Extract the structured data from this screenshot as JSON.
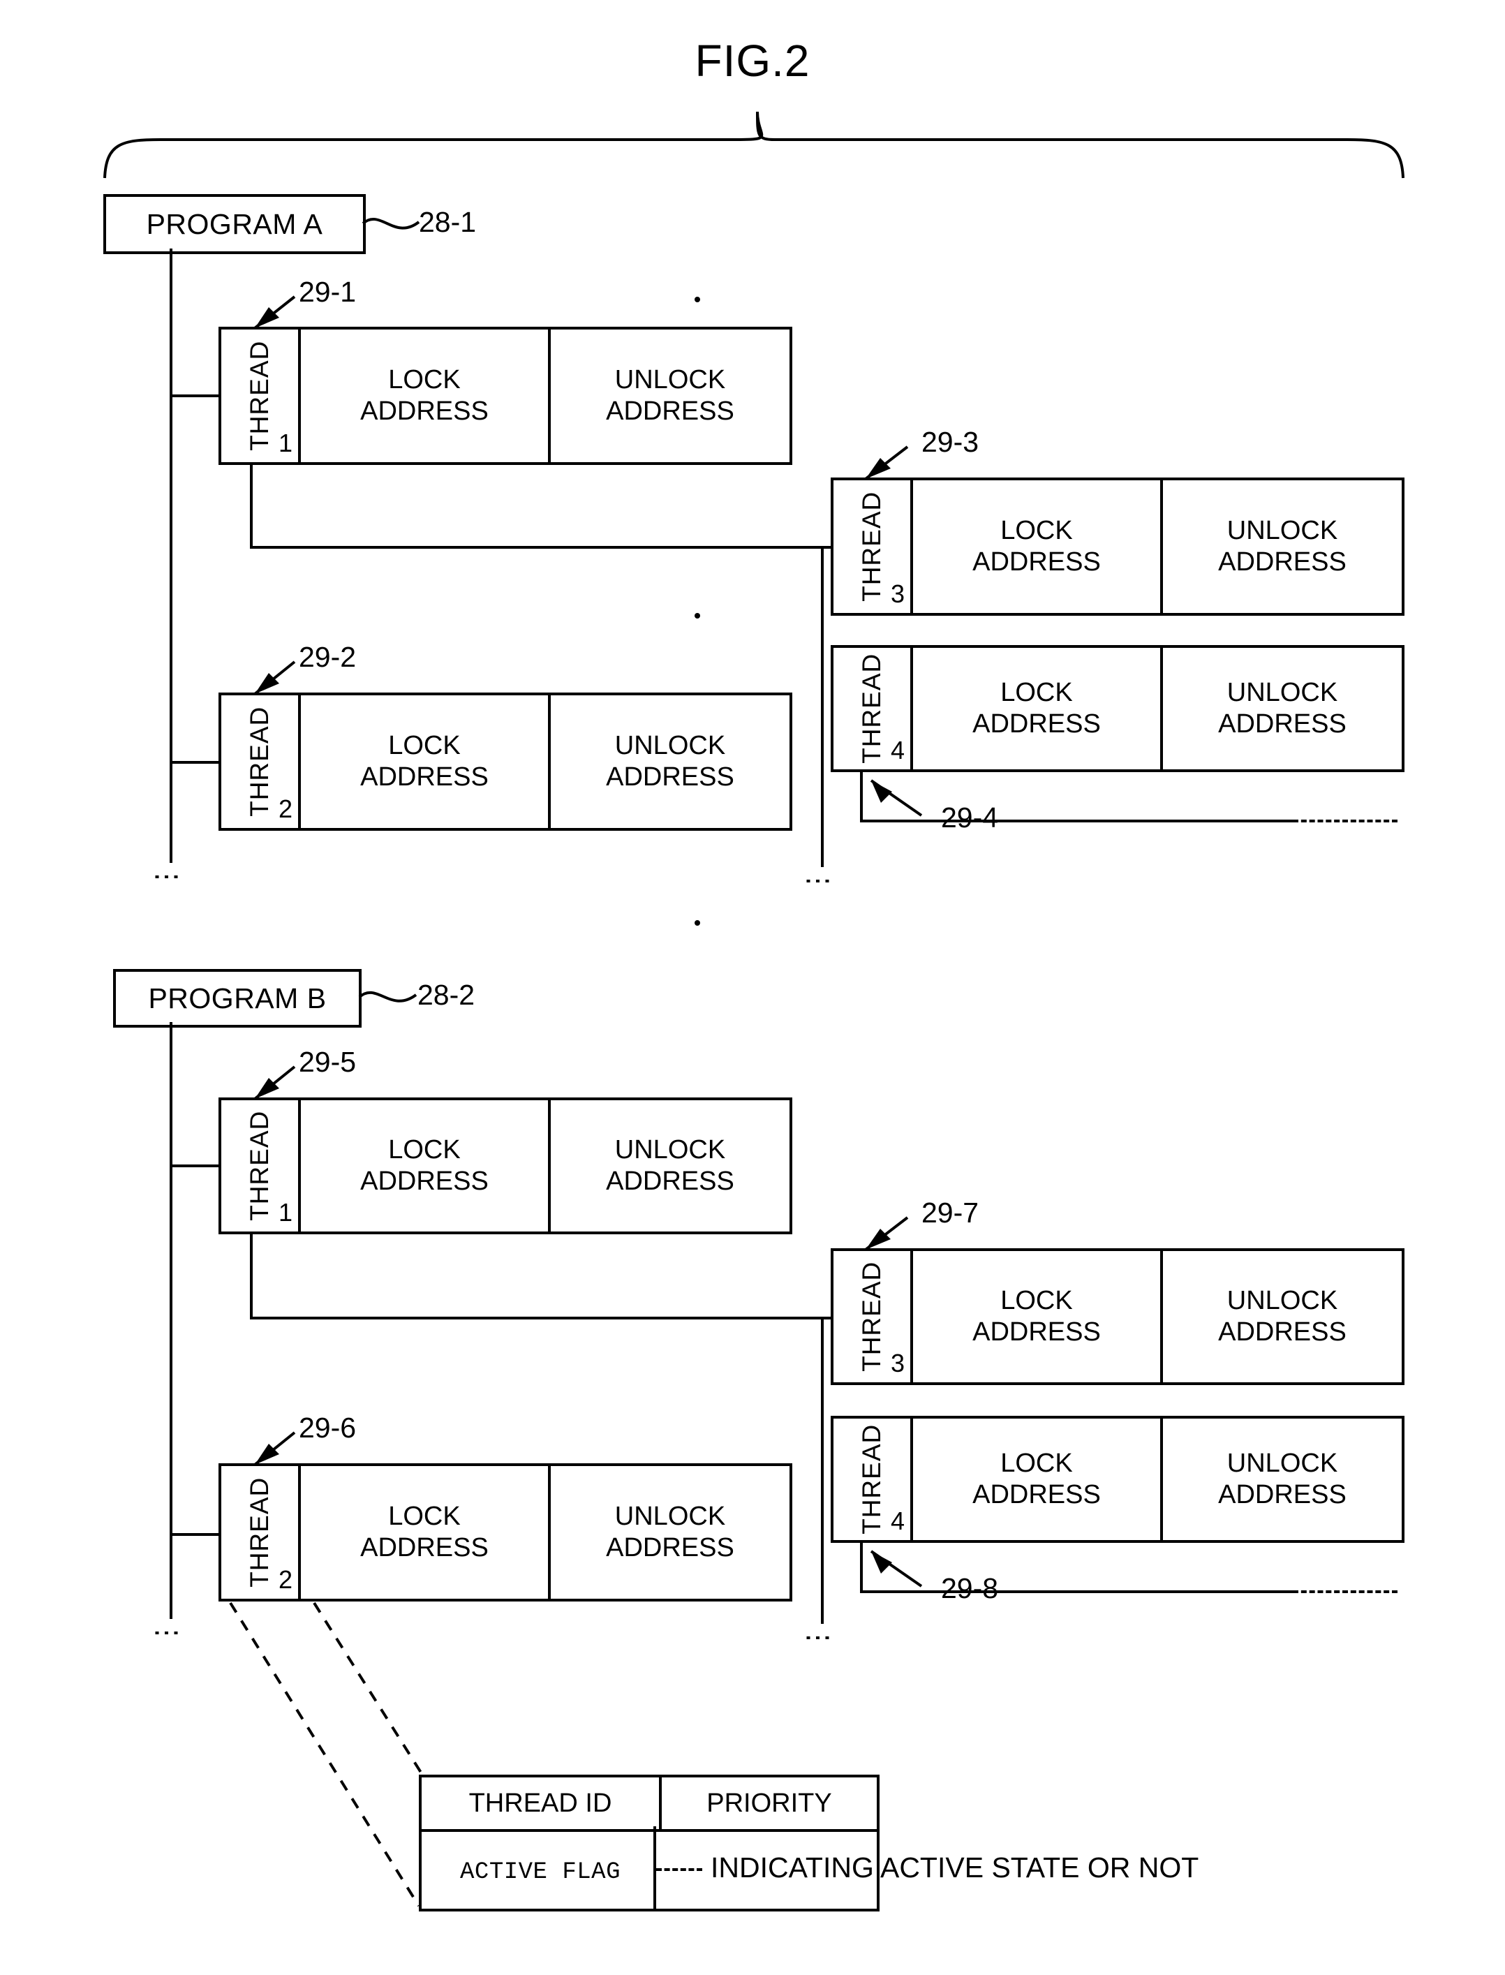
{
  "figure": {
    "title": "FIG.2"
  },
  "labels": {
    "lock": "LOCK",
    "address": "ADDRESS",
    "unlock": "UNLOCK",
    "thread": "THREAD"
  },
  "programs": [
    {
      "name": "PROGRAM A",
      "ref": "28-1"
    },
    {
      "name": "PROGRAM B",
      "ref": "28-2"
    }
  ],
  "threads": [
    {
      "label": "THREAD",
      "num": "1",
      "ref": "29-1",
      "lock": "LOCK",
      "lock2": "ADDRESS",
      "unlock": "UNLOCK",
      "unlock2": "ADDRESS"
    },
    {
      "label": "THREAD",
      "num": "3",
      "ref": "29-3",
      "lock": "LOCK",
      "lock2": "ADDRESS",
      "unlock": "UNLOCK",
      "unlock2": "ADDRESS"
    },
    {
      "label": "THREAD",
      "num": "4",
      "ref": "29-4",
      "lock": "LOCK",
      "lock2": "ADDRESS",
      "unlock": "UNLOCK",
      "unlock2": "ADDRESS"
    },
    {
      "label": "THREAD",
      "num": "2",
      "ref": "29-2",
      "lock": "LOCK",
      "lock2": "ADDRESS",
      "unlock": "UNLOCK",
      "unlock2": "ADDRESS"
    },
    {
      "label": "THREAD",
      "num": "1",
      "ref": "29-5",
      "lock": "LOCK",
      "lock2": "ADDRESS",
      "unlock": "UNLOCK",
      "unlock2": "ADDRESS"
    },
    {
      "label": "THREAD",
      "num": "3",
      "ref": "29-7",
      "lock": "LOCK",
      "lock2": "ADDRESS",
      "unlock": "UNLOCK",
      "unlock2": "ADDRESS"
    },
    {
      "label": "THREAD",
      "num": "4",
      "ref": "29-8",
      "lock": "LOCK",
      "lock2": "ADDRESS",
      "unlock": "UNLOCK",
      "unlock2": "ADDRESS"
    },
    {
      "label": "THREAD",
      "num": "2",
      "ref": "29-6",
      "lock": "LOCK",
      "lock2": "ADDRESS",
      "unlock": "UNLOCK",
      "unlock2": "ADDRESS"
    }
  ],
  "detail_table": {
    "thread_id": "THREAD ID",
    "priority": "PRIORITY",
    "active_flag": "ACTIVE FLAG",
    "note": "INDICATING ACTIVE STATE OR NOT"
  },
  "dots": {
    "vertical": "⋮"
  }
}
